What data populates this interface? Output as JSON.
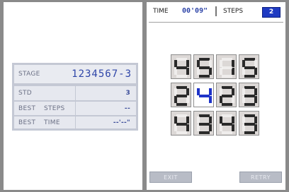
{
  "left_screen": {
    "stage_label": "STAGE",
    "stage_value": "1234567-3",
    "std_label": "STD",
    "std_value": "3",
    "best_label_1": "BEST",
    "steps_label": "STEPS",
    "best_steps_value": "--",
    "best_label_2": "BEST",
    "time_label": "TIME",
    "best_time_value": "--'--\""
  },
  "right_screen": {
    "time_label": "TIME",
    "time_value": "00'09\"",
    "steps_label": "STEPS",
    "steps_value": "2",
    "exit_label": "EXIT",
    "retry_label": "RETRY"
  },
  "grid": {
    "rows": [
      [
        "4",
        "5",
        "1",
        "5"
      ],
      [
        "2",
        "4",
        "2",
        "3"
      ],
      [
        "4",
        "3",
        "4",
        "3"
      ]
    ],
    "selected": {
      "row": 1,
      "col": 1
    },
    "colors": {
      "digit": "#2a2a2a",
      "digit_selected": "#1e33c8",
      "ghost": "#ffffff"
    }
  }
}
